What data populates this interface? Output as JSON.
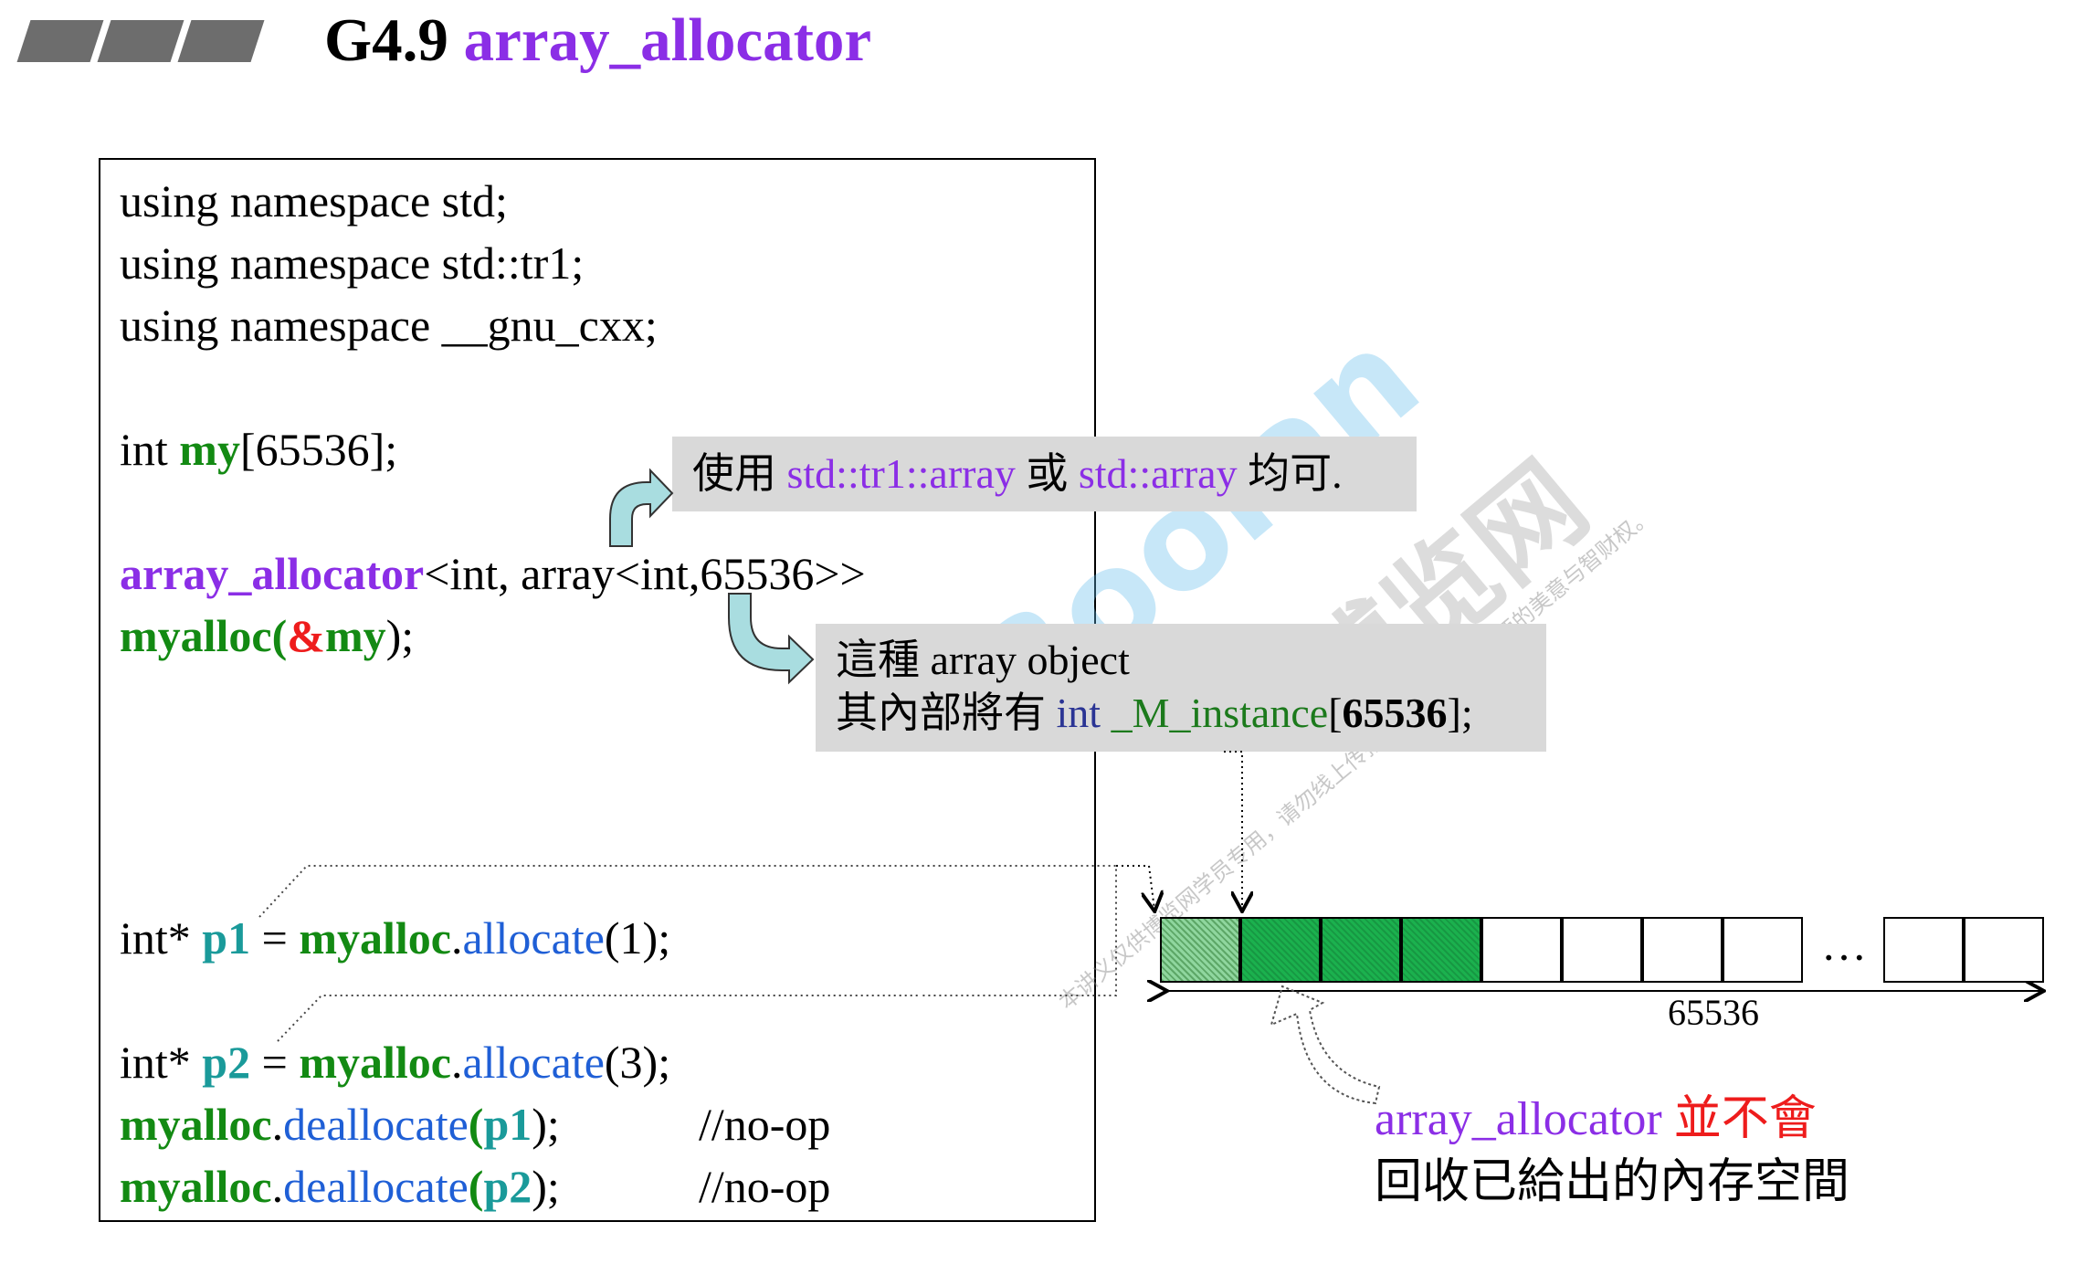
{
  "header": {
    "title_prefix": "G4.9 ",
    "title_main": "array_allocator"
  },
  "code": {
    "line1": "using namespace std;",
    "line2": "using namespace std::tr1;",
    "line3": "using namespace __gnu_cxx;",
    "line4": {
      "a": "int ",
      "b": "my",
      "c": "[65536];"
    },
    "line5": {
      "a": "array_allocator",
      "b": "<int, array<int,65536>>"
    },
    "line6": {
      "a": "myalloc",
      "b": "(",
      "c": "&",
      "d": "my",
      "e": ");"
    },
    "line7": {
      "a": "int* ",
      "b": "p1",
      "c": " = ",
      "d": "myalloc",
      "e": ".",
      "f": "allocate",
      "g": "(1);"
    },
    "line8": {
      "a": "int* ",
      "b": "p2",
      "c": " = ",
      "d": "myalloc",
      "e": ".",
      "f": "allocate",
      "g": "(3);"
    },
    "line9": {
      "a": "myalloc",
      "b": ".",
      "c": "deallocate",
      "d": "(",
      "e": "p1",
      "f": ");",
      "g": "//no-op"
    },
    "line10": {
      "a": "myalloc",
      "b": ".",
      "c": "deallocate",
      "d": "(",
      "e": "p2",
      "f": ");",
      "g": "//no-op"
    }
  },
  "note1": {
    "a": "使用 ",
    "b": "std::tr1::array",
    "c": " 或 ",
    "d": "std::array",
    "e": " 均可."
  },
  "note2": {
    "line1": "這種 array object",
    "a": "其內部將有 ",
    "b": "int",
    "c": " ",
    "d": "_M_instance",
    "e": "[",
    "f": "65536",
    "g": "];"
  },
  "diagram": {
    "ellipsis": "…",
    "size_label": "65536"
  },
  "caption": {
    "a": "array_allocator",
    "b": " 並不會",
    "line2": "回收已給出的內存空間"
  },
  "watermark": {
    "brand": "Boolan",
    "cjk": "博览网",
    "small": "本讲义仅供博览网学员专用，请勿线上传播，请尊重侯捷老师的美意与智财权。"
  },
  "colors": {
    "purple": "#8b2ee6",
    "green": "#138a13",
    "teal": "#1a9a9a",
    "red": "#ee1c1c",
    "blue": "#1f5fd6",
    "cell_green": "#1bb14e",
    "note_bg": "#d9d9d9",
    "arrow_cyan": "#a9dde0"
  }
}
